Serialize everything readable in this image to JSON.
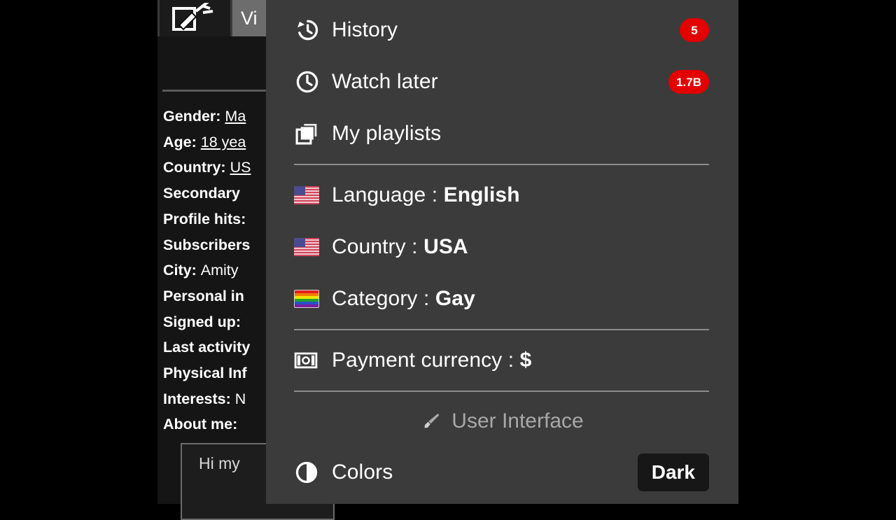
{
  "background": {
    "tabs": [
      {
        "name": "edit-tab",
        "icon": "edit-pencil-icon",
        "label": ""
      },
      {
        "name": "video-tab",
        "label": "Vi"
      }
    ],
    "profile_fields": [
      {
        "label": "Gender:",
        "value": "Ma",
        "link": true
      },
      {
        "label": "Age:",
        "value": "18 yea",
        "link": true
      },
      {
        "label": "Country:",
        "value": "US",
        "link": true
      },
      {
        "label": "Secondary",
        "value": "",
        "link": false
      },
      {
        "label": "Profile hits:",
        "value": "",
        "link": false
      },
      {
        "label": "Subscribers",
        "value": "",
        "link": false
      },
      {
        "label": "City:",
        "value": "Amity",
        "link": false
      },
      {
        "label": "Personal in",
        "value": "",
        "link": false
      },
      {
        "label": "Signed up:",
        "value": "",
        "link": false
      },
      {
        "label": "Last activity",
        "value": "",
        "link": false
      },
      {
        "label": "Physical Inf",
        "value": "",
        "link": false
      },
      {
        "label": "Interests:",
        "value": "N",
        "link": false
      },
      {
        "label": "About me:",
        "value": "",
        "link": false
      }
    ],
    "about_box_text": "Hi my"
  },
  "menu": {
    "items": [
      {
        "name": "history",
        "icon": "history-icon",
        "label": "History",
        "badge": "5",
        "badge_color": "#e20000"
      },
      {
        "name": "watch-later",
        "icon": "clock-icon",
        "label": "Watch later",
        "badge": "1.7B",
        "badge_color": "#e20000"
      },
      {
        "name": "my-playlists",
        "icon": "playlists-icon",
        "label": "My playlists",
        "badge": "",
        "badge_color": ""
      }
    ],
    "settings": [
      {
        "name": "language",
        "icon": "us-flag-icon",
        "label": "Language : ",
        "value": "English"
      },
      {
        "name": "country",
        "icon": "us-flag-icon",
        "label": "Country : ",
        "value": "USA"
      },
      {
        "name": "category",
        "icon": "pride-flag-icon",
        "label": "Category : ",
        "value": "Gay"
      }
    ],
    "payment": {
      "name": "payment-currency",
      "icon": "banknote-icon",
      "label": "Payment currency : ",
      "value": "$"
    },
    "user_interface_heading": {
      "icon": "paintbrush-icon",
      "label": "User Interface"
    },
    "colors": {
      "icon": "contrast-icon",
      "label": "Colors",
      "button_label": "Dark"
    }
  },
  "theme": {
    "panel_bg": "#3b3b3b",
    "page_bg": "#000000",
    "accent_red": "#e20000",
    "divider": "#8c8c8c",
    "muted_text": "#a8a8a8",
    "dark_button_bg": "#171717"
  }
}
